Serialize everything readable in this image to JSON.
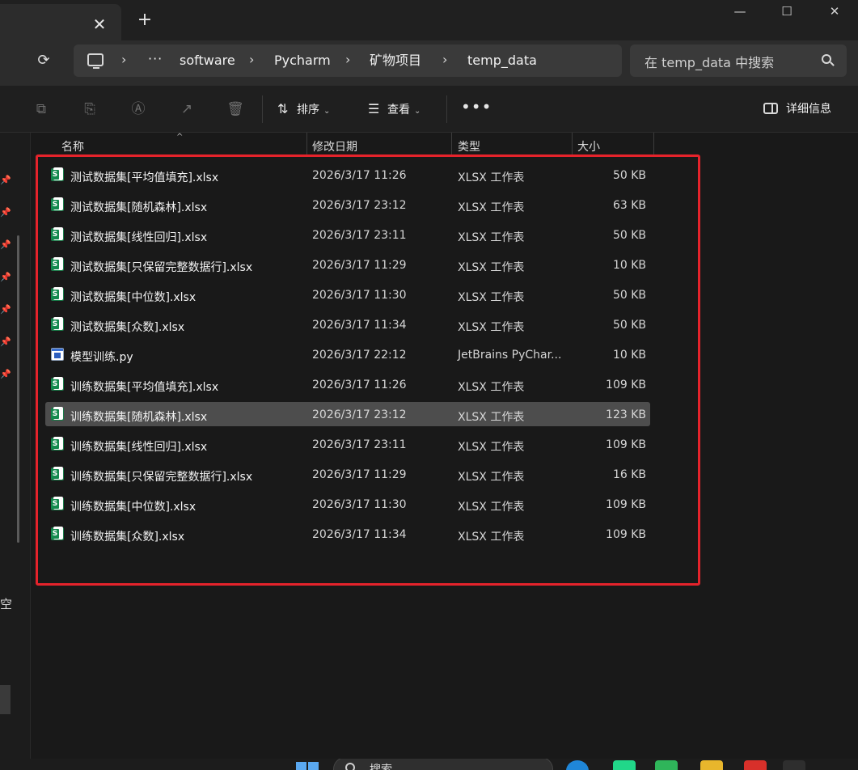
{
  "window": {
    "tab_close": "✕",
    "new_tab": "+",
    "minimize": "—",
    "maximize": "☐",
    "close": "✕"
  },
  "address": {
    "more": "···",
    "crumbs": [
      "software",
      "Pycharm",
      "矿物项目",
      "temp_data"
    ],
    "search_placeholder": "在 temp_data 中搜索"
  },
  "toolbar": {
    "sort_label": "排序",
    "view_label": "查看",
    "more": "•••",
    "details_label": "详细信息"
  },
  "columns": {
    "name": "名称",
    "date": "修改日期",
    "type": "类型",
    "size": "大小"
  },
  "files": [
    {
      "icon": "xlsx",
      "name": "测试数据集[平均值填充].xlsx",
      "date": "2026/3/17 11:26",
      "type": "XLSX 工作表",
      "size": "50 KB"
    },
    {
      "icon": "xlsx",
      "name": "测试数据集[随机森林].xlsx",
      "date": "2026/3/17 23:12",
      "type": "XLSX 工作表",
      "size": "63 KB"
    },
    {
      "icon": "xlsx",
      "name": "测试数据集[线性回归].xlsx",
      "date": "2026/3/17 23:11",
      "type": "XLSX 工作表",
      "size": "50 KB"
    },
    {
      "icon": "xlsx",
      "name": "测试数据集[只保留完整数据行].xlsx",
      "date": "2026/3/17 11:29",
      "type": "XLSX 工作表",
      "size": "10 KB"
    },
    {
      "icon": "xlsx",
      "name": "测试数据集[中位数].xlsx",
      "date": "2026/3/17 11:30",
      "type": "XLSX 工作表",
      "size": "50 KB"
    },
    {
      "icon": "xlsx",
      "name": "测试数据集[众数].xlsx",
      "date": "2026/3/17 11:34",
      "type": "XLSX 工作表",
      "size": "50 KB"
    },
    {
      "icon": "py",
      "name": "模型训练.py",
      "date": "2026/3/17 22:12",
      "type": "JetBrains PyChar...",
      "size": "10 KB"
    },
    {
      "icon": "xlsx",
      "name": "训练数据集[平均值填充].xlsx",
      "date": "2026/3/17 11:26",
      "type": "XLSX 工作表",
      "size": "109 KB"
    },
    {
      "icon": "xlsx",
      "name": "训练数据集[随机森林].xlsx",
      "date": "2026/3/17 23:12",
      "type": "XLSX 工作表",
      "size": "123 KB",
      "selected": true
    },
    {
      "icon": "xlsx",
      "name": "训练数据集[线性回归].xlsx",
      "date": "2026/3/17 23:11",
      "type": "XLSX 工作表",
      "size": "109 KB"
    },
    {
      "icon": "xlsx",
      "name": "训练数据集[只保留完整数据行].xlsx",
      "date": "2026/3/17 11:29",
      "type": "XLSX 工作表",
      "size": "16 KB"
    },
    {
      "icon": "xlsx",
      "name": "训练数据集[中位数].xlsx",
      "date": "2026/3/17 11:30",
      "type": "XLSX 工作表",
      "size": "109 KB"
    },
    {
      "icon": "xlsx",
      "name": "训练数据集[众数].xlsx",
      "date": "2026/3/17 11:34",
      "type": "XLSX 工作表",
      "size": "109 KB"
    }
  ],
  "nav": {
    "partial_label": "空"
  },
  "taskbar": {
    "search_text": "搜索"
  },
  "colors": {
    "highlight": "#e5232b",
    "selected_row": "#4d4d4d",
    "excel_green": "#138a4e"
  }
}
